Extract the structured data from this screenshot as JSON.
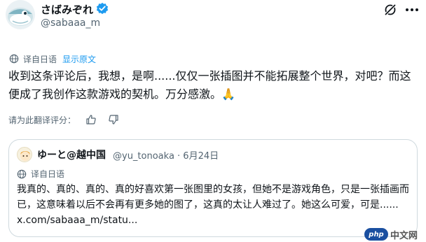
{
  "author": {
    "display_name": "さばみぞれ",
    "handle": "@sabaaa_m",
    "avatar_icon": "fish-avatar",
    "verified_color": "#1d9bf0"
  },
  "translation_bar": {
    "label": "译自日语",
    "show_original": "显示原文"
  },
  "tweet": {
    "text": "收到这条评论后，我想，是啊......仅仅一张插图并不能拓展整个世界，对吧？而这便成了我创作这款游戏的契机。万分感激。🙏"
  },
  "rate_translation": {
    "label": "请为此翻译评分："
  },
  "quote": {
    "display_name": "ゆーと@越中国",
    "meta": "@yu_tonoaka · 6月24日",
    "translated_label": "译自日语",
    "text": "我真的、真的、真的、真的好喜欢第一张图里的女孩，但她不是游戏角色，只是一张插画而已，这意味着以后不会再有更多她的图了，这真的太让人难过了。她这么可爱，可是...... x.com/sabaaa_m/statu..."
  },
  "watermark": {
    "logo_text": "php",
    "text": "中文网"
  },
  "colors": {
    "text": "#0f1419",
    "secondary": "#536471",
    "link": "#1d9bf0",
    "border": "#cfd9de"
  }
}
